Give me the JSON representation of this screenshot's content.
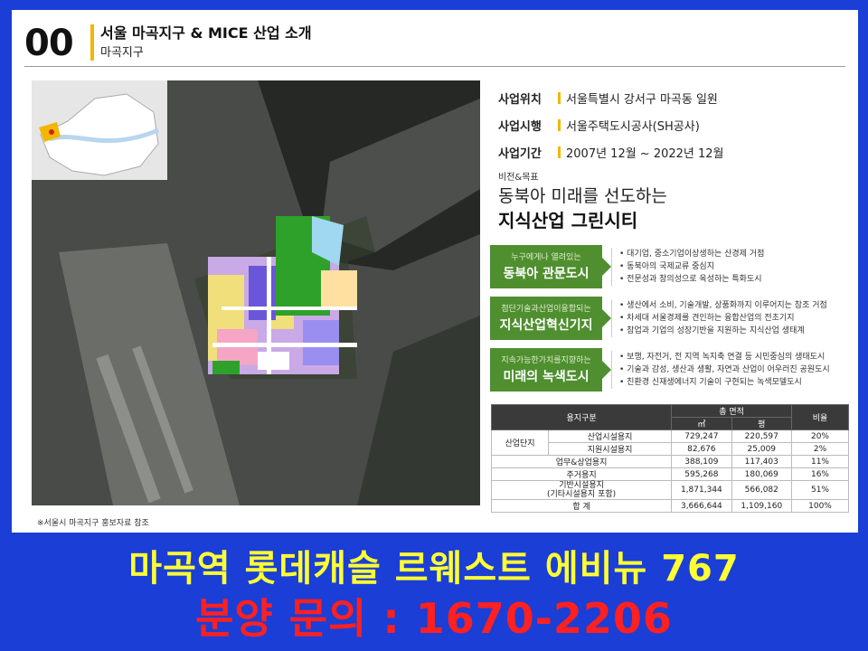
{
  "header": {
    "number": "00",
    "title": "서울 마곡지구 & MICE 산업 소개",
    "subtitle": "마곡지구"
  },
  "info": [
    {
      "key": "사업위치",
      "value": "서울특별시 강서구 마곡동 일원"
    },
    {
      "key": "사업시행",
      "value": "서울주택도시공사(SH공사)"
    },
    {
      "key": "사업기간",
      "value": "2007년 12월 ~ 2022년 12월"
    }
  ],
  "vision": {
    "tag": "비전&목표",
    "line1": "동북아 미래를 선도하는",
    "line2": "지식산업 그린시티"
  },
  "goals": [
    {
      "small": "누구에게나 열려있는",
      "main": "동북아 관문도시",
      "items": [
        "대기업, 중소기업이상생하는 산경제 거점",
        "동북아의 국제교류 중심지",
        "전문성과 창의성으로 육성하는 특화도시"
      ]
    },
    {
      "small": "첨단기술과산업이융합되는",
      "main": "지식산업혁신기지",
      "items": [
        "생산에서 소비, 기술개발, 상품화까지 이루어지는 참조 거점",
        "차세대 서울경제를 견인하는 융합산업의 전초기지",
        "참업과 기업의 성장기반을 지원하는 지식산업 생태계"
      ]
    },
    {
      "small": "지속가능한가치를지향하는",
      "main": "미래의 녹색도시",
      "items": [
        "보행, 자전거, 전 지역 녹지축 연결 등 시민중심의 생태도시",
        "기술과 감성, 생산과 생활, 자연과 산업이 어우러진 공원도시",
        "친환경 신재생에너지 기술이 구현되는 녹색모델도시"
      ]
    }
  ],
  "table": {
    "headers": {
      "category": "용지구분",
      "total": "총 면적",
      "sqm": "㎡",
      "pyeong": "평",
      "ratio": "비율"
    },
    "group_label": "산업단지",
    "rows": [
      {
        "label": "산업시설용지",
        "sqm": "729,247",
        "pyeong": "220,597",
        "ratio": "20%"
      },
      {
        "label": "지원시설용지",
        "sqm": "82,676",
        "pyeong": "25,009",
        "ratio": "2%"
      },
      {
        "label": "업무&상업용지",
        "sqm": "388,109",
        "pyeong": "117,403",
        "ratio": "11%"
      },
      {
        "label": "주거용지",
        "sqm": "595,268",
        "pyeong": "180,069",
        "ratio": "16%"
      },
      {
        "label": "기반시설용지",
        "label2": "(기타시설용지 포함)",
        "sqm": "1,871,344",
        "pyeong": "566,082",
        "ratio": "51%"
      },
      {
        "label": "합 계",
        "sqm": "3,666,644",
        "pyeong": "1,109,160",
        "ratio": "100%"
      }
    ]
  },
  "caption": "※서울시 마곡지구 홍보자료 참조",
  "banner": {
    "line1": "마곡역 롯데캐슬 르웨스트 에비뉴 767",
    "line2": "분양 문의 : 1670-2206"
  },
  "colors": {
    "accent": "#f2b705",
    "green": "#4f8f2f",
    "background": "#1a3ed6",
    "banner_yellow": "#ffff33",
    "banner_red": "#ff2020"
  }
}
